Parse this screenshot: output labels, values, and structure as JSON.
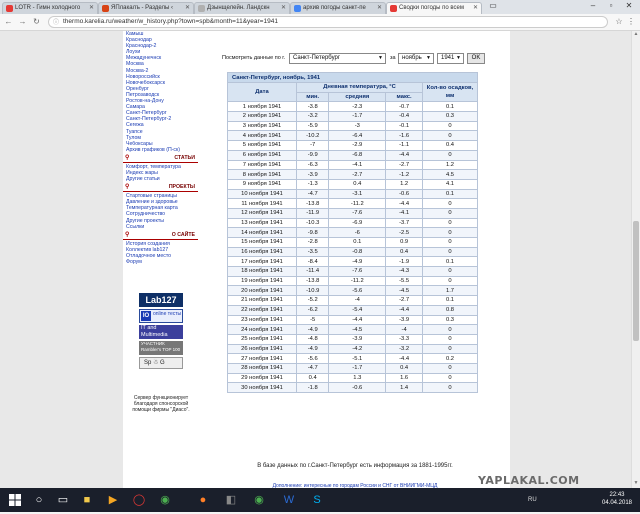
{
  "browser": {
    "tabs": [
      {
        "title": "LOTR - Гимн холодного",
        "color": "#e53935"
      },
      {
        "title": "ЯПлакалъ - Разделы ‹",
        "color": "#d84315"
      },
      {
        "title": "Дзынщелейн. Ландскн",
        "color": "#b0b0b0"
      },
      {
        "title": "архив погоды санкт-пе",
        "color": "#4285f4"
      },
      {
        "title": "Сводки погоды по всем",
        "color": "#e53935"
      }
    ],
    "active_tab": 4,
    "url": "thermo.karelia.ru/weather/w_history.php?town=spb&month=11&year=1941"
  },
  "sidebar": {
    "links_top": [
      "Камыш",
      "Краснодар",
      "Краснодар-2",
      "Лоухи",
      "Межадунечнск",
      "Москва",
      "Москва-2",
      "Новороссийск",
      "Новочебоксарск",
      "Оренбург",
      "Петрозаводск",
      "Ростов-на-Дону",
      "Самара",
      "Санкт-Петербург",
      "Санкт-Петербург-2",
      "Сегежа",
      "Туапсе",
      "Тулом",
      "Чебоксары",
      "Архив графиков (П-ск)"
    ],
    "sections": [
      {
        "title": "СТАТЬИ",
        "links": [
          "Комфорт, температура",
          "Индекс жары",
          "Другие статьи"
        ]
      },
      {
        "title": "ПРОЕКТЫ",
        "links": [
          "Стартовые страницы",
          "Давление и здоровье",
          "Температурная карта",
          "Сотрудничество",
          "Другие проекты",
          "Ссылки"
        ]
      },
      {
        "title": "О САЙТЕ",
        "links": [
          "История создания",
          "Коллектив lab127",
          "Отладочное место",
          "Форум"
        ]
      }
    ],
    "badges": {
      "lab": "Lab127",
      "io_mark": "IO",
      "io_text": "online тесты",
      "mm_text": "IT and Multimedia",
      "rambler_text": "УЧАСТНИК Rambler's TOP 100",
      "spb_text": "Sp ☃ G"
    },
    "sponsor": "Сервер функционирует благодаря спонсорской помощи фирмы \"Диасо\"."
  },
  "controls": {
    "label_show": "Посмотреть данные по г.",
    "city": "Санкт-Петербург",
    "label_for": "за",
    "month": "ноябрь",
    "year": "1941",
    "ok": "OK"
  },
  "table": {
    "caption": "Санкт-Петербург, ноябрь, 1941",
    "headers": {
      "date": "Дата",
      "temp_group": "Дневная температура, °С",
      "min": "мин.",
      "avg": "средняя",
      "max": "макс.",
      "precip": "Кол-во осадков, мм"
    },
    "rows": [
      [
        "1 ноября 1941",
        "-3.8",
        "-2.3",
        "-0.7",
        "0.1"
      ],
      [
        "2 ноября 1941",
        "-3.2",
        "-1.7",
        "-0.4",
        "0.3"
      ],
      [
        "3 ноября 1941",
        "-5.9",
        "-3",
        "-0.1",
        "0"
      ],
      [
        "4 ноября 1941",
        "-10.2",
        "-6.4",
        "-1.6",
        "0"
      ],
      [
        "5 ноября 1941",
        "-7",
        "-2.9",
        "-1.1",
        "0.4"
      ],
      [
        "6 ноября 1941",
        "-9.9",
        "-6.8",
        "-4.4",
        "0"
      ],
      [
        "7 ноября 1941",
        "-6.3",
        "-4.1",
        "-2.7",
        "1.2"
      ],
      [
        "8 ноября 1941",
        "-3.9",
        "-2.7",
        "-1.2",
        "4.5"
      ],
      [
        "9 ноября 1941",
        "-1.3",
        "0.4",
        "1.2",
        "4.1"
      ],
      [
        "10 ноября 1941",
        "-4.7",
        "-3.1",
        "-0.6",
        "0.1"
      ],
      [
        "11 ноября 1941",
        "-13.8",
        "-11.2",
        "-4.4",
        "0"
      ],
      [
        "12 ноября 1941",
        "-11.9",
        "-7.6",
        "-4.1",
        "0"
      ],
      [
        "13 ноября 1941",
        "-10.3",
        "-6.9",
        "-3.7",
        "0"
      ],
      [
        "14 ноября 1941",
        "-9.8",
        "-6",
        "-2.5",
        "0"
      ],
      [
        "15 ноября 1941",
        "-2.8",
        "0.1",
        "0.9",
        "0"
      ],
      [
        "16 ноября 1941",
        "-3.5",
        "-0.8",
        "0.4",
        "0"
      ],
      [
        "17 ноября 1941",
        "-8.4",
        "-4.9",
        "-1.9",
        "0.1"
      ],
      [
        "18 ноября 1941",
        "-11.4",
        "-7.6",
        "-4.3",
        "0"
      ],
      [
        "19 ноября 1941",
        "-13.8",
        "-11.2",
        "-5.5",
        "0"
      ],
      [
        "20 ноября 1941",
        "-10.9",
        "-5.6",
        "-4.5",
        "1.7"
      ],
      [
        "21 ноября 1941",
        "-5.2",
        "-4",
        "-2.7",
        "0.1"
      ],
      [
        "22 ноября 1941",
        "-6.2",
        "-5.4",
        "-4.4",
        "0.8"
      ],
      [
        "23 ноября 1941",
        "-5",
        "-4.4",
        "-3.9",
        "0.3"
      ],
      [
        "24 ноября 1941",
        "-4.9",
        "-4.5",
        "-4",
        "0"
      ],
      [
        "25 ноября 1941",
        "-4.8",
        "-3.9",
        "-3.3",
        "0"
      ],
      [
        "26 ноября 1941",
        "-4.9",
        "-4.2",
        "-3.2",
        "0"
      ],
      [
        "27 ноября 1941",
        "-5.6",
        "-5.1",
        "-4.4",
        "0.2"
      ],
      [
        "28 ноября 1941",
        "-4.7",
        "-1.7",
        "0.4",
        "0"
      ],
      [
        "29 ноября 1941",
        "0.4",
        "1.3",
        "1.6",
        "0"
      ],
      [
        "30 ноября 1941",
        "-1.8",
        "-0.6",
        "1.4",
        "0"
      ]
    ]
  },
  "footnote": "В базе данных по г.Санкт-Петербург есть информация за 1881-1995гг.",
  "footnote2": "Дополнение: интересные по городам России и СНГ от ВНИИГМИ-МЦД",
  "watermark": "YAPLAKAL.COM",
  "taskbar": {
    "lang": "RU",
    "time": "22:43",
    "date": "04.04.2018"
  },
  "colors": {
    "link": "#1a3bb3",
    "table_header": "#d8e4f2",
    "table_caption": "#c8d9ec",
    "section_rule": "#aa0000",
    "taskbar": "#1a1f2b"
  }
}
